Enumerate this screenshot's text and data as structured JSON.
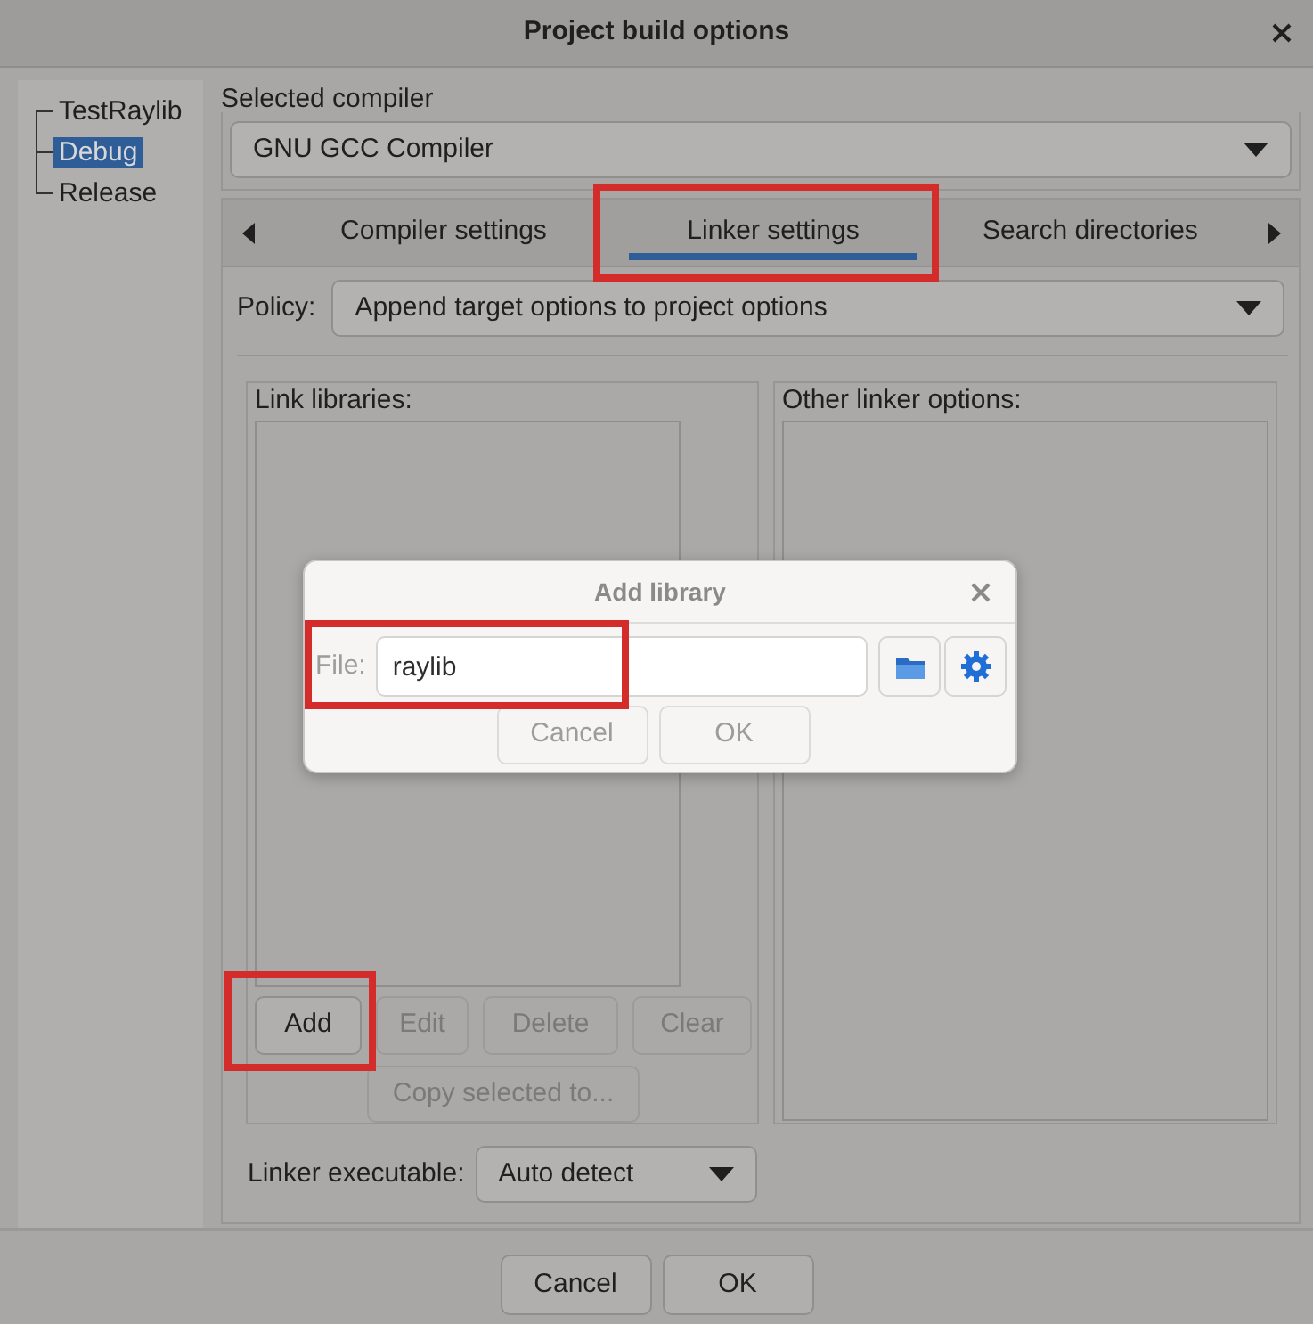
{
  "window": {
    "title": "Project build options"
  },
  "tree": [
    {
      "label": "TestRaylib",
      "selected": false,
      "children": [
        {
          "label": "Debug",
          "selected": true
        },
        {
          "label": "Release",
          "selected": false
        }
      ]
    }
  ],
  "compiler": {
    "label": "Selected compiler",
    "value": "GNU GCC Compiler"
  },
  "tabs": [
    {
      "label": "Compiler settings",
      "selected": false,
      "highlighted": false
    },
    {
      "label": "Linker settings",
      "selected": true,
      "highlighted": true
    },
    {
      "label": "Search directories",
      "selected": false,
      "highlighted": false
    }
  ],
  "policy": {
    "label": "Policy:",
    "value": "Append target options to project options"
  },
  "link_libraries": {
    "title": "Link libraries:",
    "buttons": [
      {
        "label": "Add",
        "disabled": false,
        "highlighted": true
      },
      {
        "label": "Edit",
        "disabled": true,
        "highlighted": false
      },
      {
        "label": "Delete",
        "disabled": true,
        "highlighted": false
      },
      {
        "label": "Clear",
        "disabled": true,
        "highlighted": false
      }
    ],
    "copy_button": {
      "label": "Copy selected to...",
      "disabled": true
    }
  },
  "other_linker_options": {
    "title": "Other linker options:"
  },
  "linker_executable": {
    "label": "Linker executable:",
    "value": "Auto detect"
  },
  "footer_buttons": [
    {
      "label": "Cancel",
      "disabled": false
    },
    {
      "label": "OK",
      "disabled": false
    }
  ],
  "dialog": {
    "title": "Add library",
    "file_label": "File:",
    "file_value": "raylib",
    "file_highlighted": true,
    "buttons": [
      {
        "label": "Cancel",
        "disabled": true
      },
      {
        "label": "OK",
        "disabled": true
      }
    ]
  }
}
